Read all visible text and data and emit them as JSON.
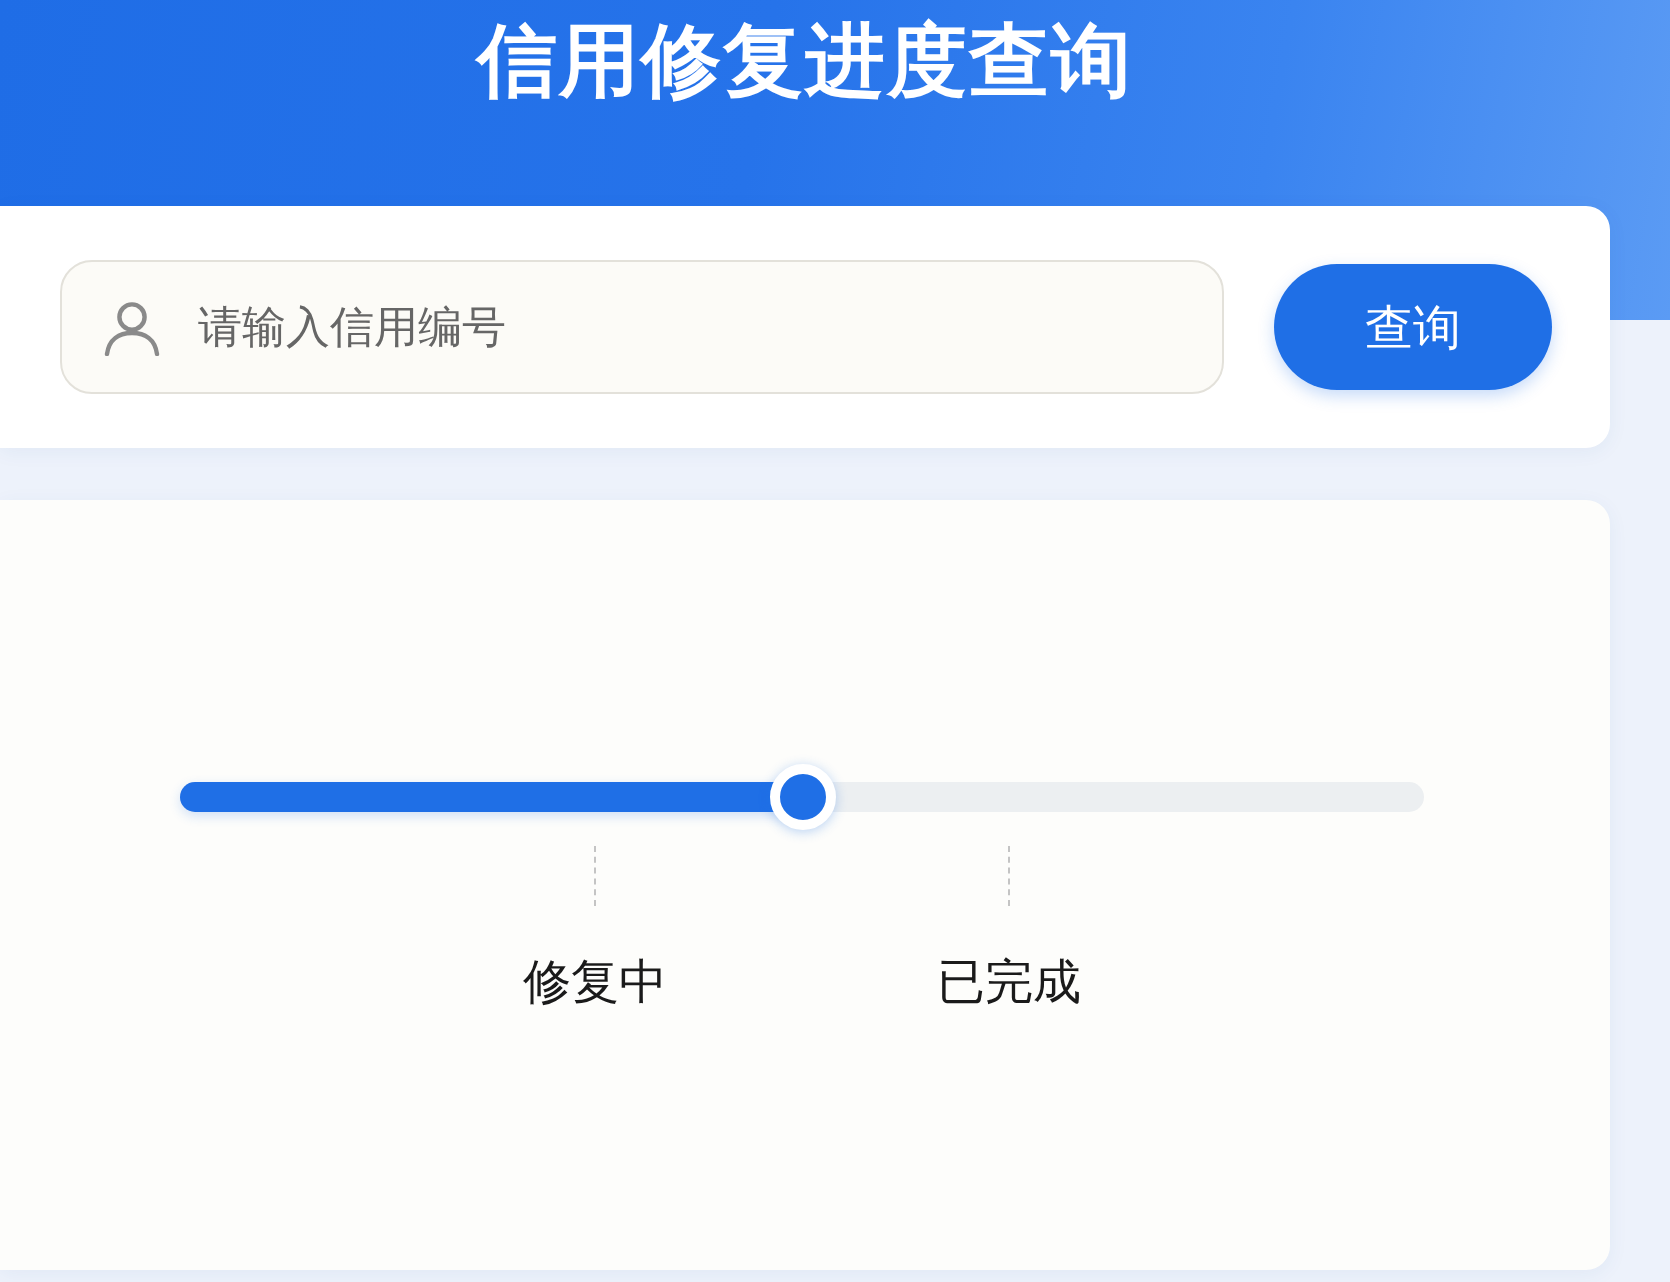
{
  "header": {
    "title": "信用修复进度查询"
  },
  "search": {
    "placeholder": "请输入信用编号",
    "button": "查询"
  },
  "progress": {
    "level": 0.5,
    "milestones": [
      {
        "label": "修复中"
      },
      {
        "label": "已完成"
      }
    ]
  }
}
